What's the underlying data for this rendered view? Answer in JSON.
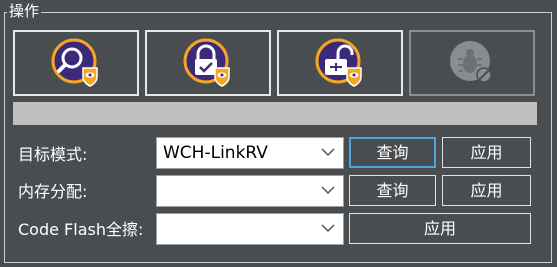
{
  "group": {
    "title": "操作"
  },
  "toolbar": {
    "buttons": [
      {
        "icon": "search-eye-shield-icon"
      },
      {
        "icon": "lock-closed-eye-shield-icon"
      },
      {
        "icon": "lock-open-eye-shield-icon"
      },
      {
        "icon": "bug-disabled-icon"
      }
    ]
  },
  "progress": {
    "value": 0
  },
  "rows": {
    "target_mode": {
      "label": "目标模式:",
      "value": "WCH-LinkRV",
      "query": "查询",
      "apply": "应用"
    },
    "memory": {
      "label": "内存分配:",
      "value": "",
      "query": "查询",
      "apply": "应用"
    },
    "code_flash": {
      "label": "Code Flash全擦:",
      "value": "",
      "apply": "应用"
    }
  },
  "colors": {
    "accent": "#f5a623",
    "icon_purple": "#3b2a7a",
    "focus": "#4fa3e0"
  }
}
